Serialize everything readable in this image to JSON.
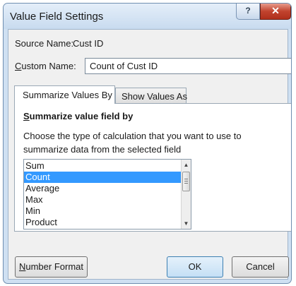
{
  "dialog": {
    "title": "Value Field Settings",
    "help_glyph": "?",
    "close_glyph": "✕"
  },
  "source": {
    "label": "Source Name:",
    "value": "Cust ID"
  },
  "custom_name": {
    "label_accel": "C",
    "label_rest": "ustom Name:",
    "value": "Count of Cust ID"
  },
  "tabs": [
    {
      "label": "Summarize Values By",
      "active": true
    },
    {
      "label": "Show Values As",
      "active": false
    }
  ],
  "summarize": {
    "heading_accel": "S",
    "heading_rest": "ummarize value field by",
    "description": "Choose the type of calculation that you want to use to summarize data from the selected field",
    "options": [
      "Sum",
      "Count",
      "Average",
      "Max",
      "Min",
      "Product"
    ],
    "selected": "Count",
    "scroll_up_glyph": "▲",
    "scroll_down_glyph": "▼"
  },
  "buttons": {
    "number_format_accel": "N",
    "number_format_rest": "umber Format",
    "ok": "OK",
    "cancel": "Cancel"
  },
  "colors": {
    "selection": "#3399ff",
    "close_button": "#c1432e",
    "title_bar": "#cfe0f2"
  }
}
